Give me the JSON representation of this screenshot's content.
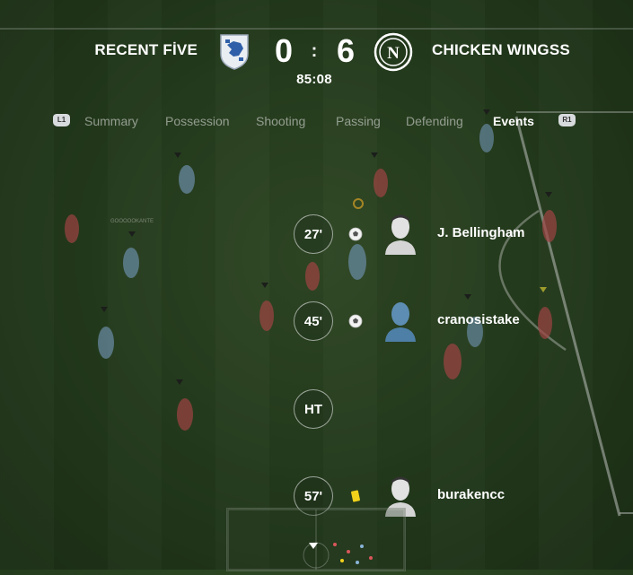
{
  "scoreboard": {
    "home_team": "RECENT FİVE",
    "away_team": "CHICKEN WINGSS",
    "home_score": "0",
    "separator": ":",
    "away_score": "6",
    "clock": "85:08"
  },
  "tabs": {
    "left_button": "L1",
    "right_button": "R1",
    "items": [
      "Summary",
      "Possession",
      "Shooting",
      "Passing",
      "Defending",
      "Events"
    ],
    "active": "Events"
  },
  "events": [
    {
      "minute": "27'",
      "type": "goal",
      "icon": "football-icon",
      "player": "J. Bellingham"
    },
    {
      "minute": "45'",
      "type": "goal",
      "icon": "football-icon",
      "player": "cranosistake"
    },
    {
      "minute": "HT",
      "type": "half-time"
    },
    {
      "minute": "57'",
      "type": "yellow-card",
      "icon": "yellow-card-icon",
      "player": "burakencc"
    }
  ],
  "pitch_label": "GOOOOOKANTE",
  "colors": {
    "pitch": "#2c4722",
    "home_kit": "#8ab4d8",
    "away_kit": "#d9565a",
    "yellow_card": "#f2d21b"
  }
}
